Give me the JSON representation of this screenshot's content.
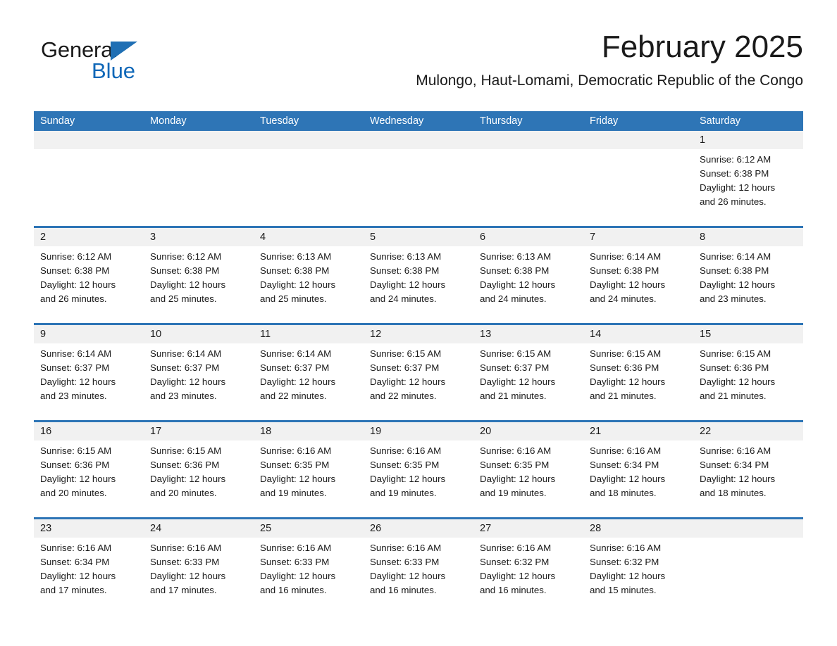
{
  "brand": {
    "name_part1": "General",
    "name_part2": "Blue",
    "triangle_color": "#1f6fb4",
    "blue_text_color": "#1068b8"
  },
  "header": {
    "month_title": "February 2025",
    "location": "Mulongo, Haut-Lomami, Democratic Republic of the Congo",
    "accent_color": "#2e75b6",
    "numrow_color": "#f1f1f1"
  },
  "calendar": {
    "weekday_headers": [
      "Sunday",
      "Monday",
      "Tuesday",
      "Wednesday",
      "Thursday",
      "Friday",
      "Saturday"
    ],
    "weeks": [
      [
        {
          "day": "",
          "lines": []
        },
        {
          "day": "",
          "lines": []
        },
        {
          "day": "",
          "lines": []
        },
        {
          "day": "",
          "lines": []
        },
        {
          "day": "",
          "lines": []
        },
        {
          "day": "",
          "lines": []
        },
        {
          "day": "1",
          "lines": [
            "Sunrise: 6:12 AM",
            "Sunset: 6:38 PM",
            "Daylight: 12 hours",
            "and 26 minutes."
          ]
        }
      ],
      [
        {
          "day": "2",
          "lines": [
            "Sunrise: 6:12 AM",
            "Sunset: 6:38 PM",
            "Daylight: 12 hours",
            "and 26 minutes."
          ]
        },
        {
          "day": "3",
          "lines": [
            "Sunrise: 6:12 AM",
            "Sunset: 6:38 PM",
            "Daylight: 12 hours",
            "and 25 minutes."
          ]
        },
        {
          "day": "4",
          "lines": [
            "Sunrise: 6:13 AM",
            "Sunset: 6:38 PM",
            "Daylight: 12 hours",
            "and 25 minutes."
          ]
        },
        {
          "day": "5",
          "lines": [
            "Sunrise: 6:13 AM",
            "Sunset: 6:38 PM",
            "Daylight: 12 hours",
            "and 24 minutes."
          ]
        },
        {
          "day": "6",
          "lines": [
            "Sunrise: 6:13 AM",
            "Sunset: 6:38 PM",
            "Daylight: 12 hours",
            "and 24 minutes."
          ]
        },
        {
          "day": "7",
          "lines": [
            "Sunrise: 6:14 AM",
            "Sunset: 6:38 PM",
            "Daylight: 12 hours",
            "and 24 minutes."
          ]
        },
        {
          "day": "8",
          "lines": [
            "Sunrise: 6:14 AM",
            "Sunset: 6:38 PM",
            "Daylight: 12 hours",
            "and 23 minutes."
          ]
        }
      ],
      [
        {
          "day": "9",
          "lines": [
            "Sunrise: 6:14 AM",
            "Sunset: 6:37 PM",
            "Daylight: 12 hours",
            "and 23 minutes."
          ]
        },
        {
          "day": "10",
          "lines": [
            "Sunrise: 6:14 AM",
            "Sunset: 6:37 PM",
            "Daylight: 12 hours",
            "and 23 minutes."
          ]
        },
        {
          "day": "11",
          "lines": [
            "Sunrise: 6:14 AM",
            "Sunset: 6:37 PM",
            "Daylight: 12 hours",
            "and 22 minutes."
          ]
        },
        {
          "day": "12",
          "lines": [
            "Sunrise: 6:15 AM",
            "Sunset: 6:37 PM",
            "Daylight: 12 hours",
            "and 22 minutes."
          ]
        },
        {
          "day": "13",
          "lines": [
            "Sunrise: 6:15 AM",
            "Sunset: 6:37 PM",
            "Daylight: 12 hours",
            "and 21 minutes."
          ]
        },
        {
          "day": "14",
          "lines": [
            "Sunrise: 6:15 AM",
            "Sunset: 6:36 PM",
            "Daylight: 12 hours",
            "and 21 minutes."
          ]
        },
        {
          "day": "15",
          "lines": [
            "Sunrise: 6:15 AM",
            "Sunset: 6:36 PM",
            "Daylight: 12 hours",
            "and 21 minutes."
          ]
        }
      ],
      [
        {
          "day": "16",
          "lines": [
            "Sunrise: 6:15 AM",
            "Sunset: 6:36 PM",
            "Daylight: 12 hours",
            "and 20 minutes."
          ]
        },
        {
          "day": "17",
          "lines": [
            "Sunrise: 6:15 AM",
            "Sunset: 6:36 PM",
            "Daylight: 12 hours",
            "and 20 minutes."
          ]
        },
        {
          "day": "18",
          "lines": [
            "Sunrise: 6:16 AM",
            "Sunset: 6:35 PM",
            "Daylight: 12 hours",
            "and 19 minutes."
          ]
        },
        {
          "day": "19",
          "lines": [
            "Sunrise: 6:16 AM",
            "Sunset: 6:35 PM",
            "Daylight: 12 hours",
            "and 19 minutes."
          ]
        },
        {
          "day": "20",
          "lines": [
            "Sunrise: 6:16 AM",
            "Sunset: 6:35 PM",
            "Daylight: 12 hours",
            "and 19 minutes."
          ]
        },
        {
          "day": "21",
          "lines": [
            "Sunrise: 6:16 AM",
            "Sunset: 6:34 PM",
            "Daylight: 12 hours",
            "and 18 minutes."
          ]
        },
        {
          "day": "22",
          "lines": [
            "Sunrise: 6:16 AM",
            "Sunset: 6:34 PM",
            "Daylight: 12 hours",
            "and 18 minutes."
          ]
        }
      ],
      [
        {
          "day": "23",
          "lines": [
            "Sunrise: 6:16 AM",
            "Sunset: 6:34 PM",
            "Daylight: 12 hours",
            "and 17 minutes."
          ]
        },
        {
          "day": "24",
          "lines": [
            "Sunrise: 6:16 AM",
            "Sunset: 6:33 PM",
            "Daylight: 12 hours",
            "and 17 minutes."
          ]
        },
        {
          "day": "25",
          "lines": [
            "Sunrise: 6:16 AM",
            "Sunset: 6:33 PM",
            "Daylight: 12 hours",
            "and 16 minutes."
          ]
        },
        {
          "day": "26",
          "lines": [
            "Sunrise: 6:16 AM",
            "Sunset: 6:33 PM",
            "Daylight: 12 hours",
            "and 16 minutes."
          ]
        },
        {
          "day": "27",
          "lines": [
            "Sunrise: 6:16 AM",
            "Sunset: 6:32 PM",
            "Daylight: 12 hours",
            "and 16 minutes."
          ]
        },
        {
          "day": "28",
          "lines": [
            "Sunrise: 6:16 AM",
            "Sunset: 6:32 PM",
            "Daylight: 12 hours",
            "and 15 minutes."
          ]
        },
        {
          "day": "",
          "lines": []
        }
      ]
    ]
  }
}
